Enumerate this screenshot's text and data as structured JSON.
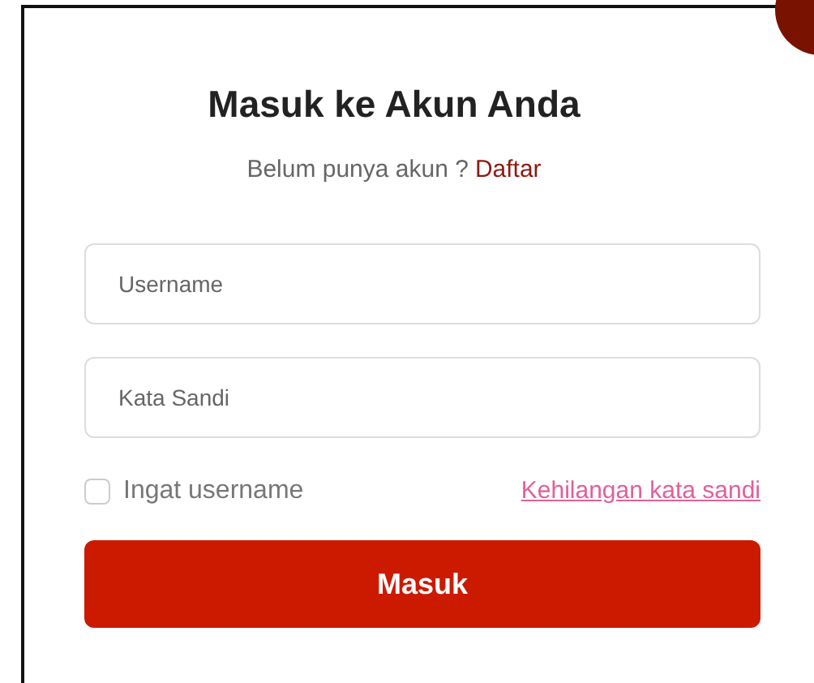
{
  "title": "Masuk ke Akun Anda",
  "signup": {
    "prompt": "Belum punya akun ?",
    "link": "Daftar"
  },
  "fields": [
    {
      "placeholder": "Username"
    },
    {
      "placeholder": "Kata Sandi"
    }
  ],
  "remember": {
    "label": "Ingat username",
    "checked": false
  },
  "forgot_link": "Kehilangan kata sandi",
  "submit": "Masuk"
}
